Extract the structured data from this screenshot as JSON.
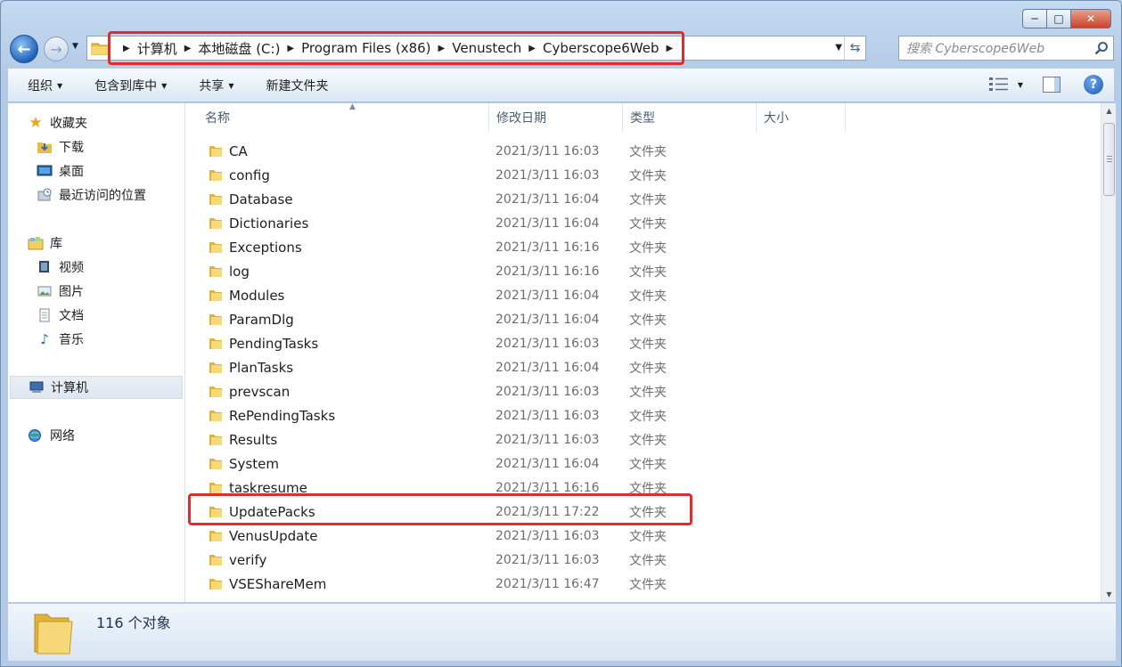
{
  "window": {
    "caption_min": "─",
    "caption_max": "□",
    "caption_close": "✕"
  },
  "nav": {
    "back": "←",
    "forward": "→"
  },
  "breadcrumb": [
    "计算机",
    "本地磁盘 (C:)",
    "Program Files (x86)",
    "Venustech",
    "Cyberscope6Web"
  ],
  "search": {
    "placeholder": "搜索 Cyberscope6Web"
  },
  "toolbar": {
    "organize": "组织",
    "include_library": "包含到库中",
    "share": "共享",
    "new_folder": "新建文件夹",
    "help": "?"
  },
  "sidebar": {
    "favorites": {
      "label": "收藏夹",
      "items": [
        {
          "label": "下载"
        },
        {
          "label": "桌面"
        },
        {
          "label": "最近访问的位置"
        }
      ]
    },
    "libraries": {
      "label": "库",
      "items": [
        {
          "label": "视频"
        },
        {
          "label": "图片"
        },
        {
          "label": "文档"
        },
        {
          "label": "音乐"
        }
      ]
    },
    "computer": {
      "label": "计算机"
    },
    "network": {
      "label": "网络"
    }
  },
  "columns": {
    "name": "名称",
    "date": "修改日期",
    "type": "类型",
    "size": "大小"
  },
  "files": [
    {
      "name": "CA",
      "date": "2021/3/11 16:03",
      "type": "文件夹"
    },
    {
      "name": "config",
      "date": "2021/3/11 16:03",
      "type": "文件夹"
    },
    {
      "name": "Database",
      "date": "2021/3/11 16:04",
      "type": "文件夹"
    },
    {
      "name": "Dictionaries",
      "date": "2021/3/11 16:04",
      "type": "文件夹"
    },
    {
      "name": "Exceptions",
      "date": "2021/3/11 16:16",
      "type": "文件夹"
    },
    {
      "name": "log",
      "date": "2021/3/11 16:16",
      "type": "文件夹"
    },
    {
      "name": "Modules",
      "date": "2021/3/11 16:04",
      "type": "文件夹"
    },
    {
      "name": "ParamDlg",
      "date": "2021/3/11 16:04",
      "type": "文件夹"
    },
    {
      "name": "PendingTasks",
      "date": "2021/3/11 16:03",
      "type": "文件夹"
    },
    {
      "name": "PlanTasks",
      "date": "2021/3/11 16:04",
      "type": "文件夹"
    },
    {
      "name": "prevscan",
      "date": "2021/3/11 16:03",
      "type": "文件夹"
    },
    {
      "name": "RePendingTasks",
      "date": "2021/3/11 16:03",
      "type": "文件夹"
    },
    {
      "name": "Results",
      "date": "2021/3/11 16:03",
      "type": "文件夹"
    },
    {
      "name": "System",
      "date": "2021/3/11 16:04",
      "type": "文件夹"
    },
    {
      "name": "taskresume",
      "date": "2021/3/11 16:16",
      "type": "文件夹"
    },
    {
      "name": "UpdatePacks",
      "date": "2021/3/11 17:22",
      "type": "文件夹"
    },
    {
      "name": "VenusUpdate",
      "date": "2021/3/11 16:03",
      "type": "文件夹"
    },
    {
      "name": "verify",
      "date": "2021/3/11 16:03",
      "type": "文件夹"
    },
    {
      "name": "VSEShareMem",
      "date": "2021/3/11 16:47",
      "type": "文件夹"
    }
  ],
  "status": {
    "count": "116 个对象"
  },
  "colors": {
    "highlight": "#e52a2a",
    "folder": "#f2c94c",
    "accent": "#1f62b8"
  }
}
